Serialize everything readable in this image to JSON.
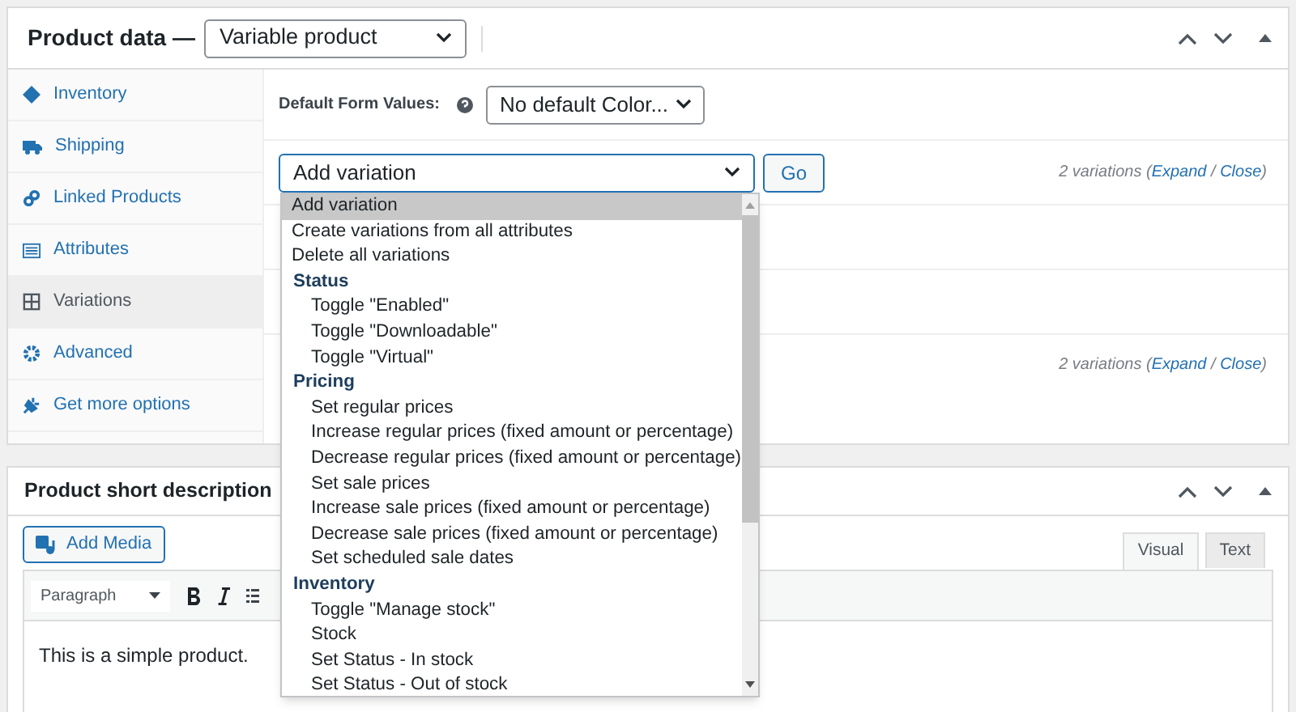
{
  "product_data": {
    "title": "Product data —",
    "type_select": "Variable product",
    "tabs": [
      {
        "label": "Inventory",
        "selected": false
      },
      {
        "label": "Shipping",
        "selected": false
      },
      {
        "label": "Linked Products",
        "selected": false
      },
      {
        "label": "Attributes",
        "selected": false
      },
      {
        "label": "Variations",
        "selected": true
      },
      {
        "label": "Advanced",
        "selected": false
      },
      {
        "label": "Get more options",
        "selected": false
      }
    ],
    "default_form_label": "Default Form Values:",
    "default_select": "No default Color...",
    "add_variation_select": "Add variation",
    "go_button": "Go",
    "variation_counts": [
      {
        "prefix": "2 variations (",
        "expand": "Expand",
        "separator": "/",
        "close": "Close",
        "suffix": ")"
      },
      {
        "prefix": "2 variations (",
        "expand": "Expand",
        "separator": "/",
        "close": "Close",
        "suffix": ")"
      }
    ],
    "dropdown": [
      {
        "kind": "option",
        "label": "Add variation",
        "selected": true
      },
      {
        "kind": "option",
        "label": "Create variations from all attributes",
        "selected": false
      },
      {
        "kind": "option",
        "label": "Delete all variations",
        "selected": false
      },
      {
        "kind": "group",
        "label": "Status",
        "children": [
          {
            "label": "Toggle \"Enabled\"",
            "selected": false
          },
          {
            "label": "Toggle \"Downloadable\"",
            "selected": false
          },
          {
            "label": "Toggle \"Virtual\"",
            "selected": false
          }
        ]
      },
      {
        "kind": "group",
        "label": "Pricing",
        "children": [
          {
            "label": "Set regular prices",
            "selected": false
          },
          {
            "label": "Increase regular prices (fixed amount or percentage)",
            "selected": false
          },
          {
            "label": "Decrease regular prices (fixed amount or percentage)",
            "selected": false
          },
          {
            "label": "Set sale prices",
            "selected": false
          },
          {
            "label": "Increase sale prices (fixed amount or percentage)",
            "selected": false
          },
          {
            "label": "Decrease sale prices (fixed amount or percentage)",
            "selected": false
          },
          {
            "label": "Set scheduled sale dates",
            "selected": false
          }
        ]
      },
      {
        "kind": "group",
        "label": "Inventory",
        "children": [
          {
            "label": "Toggle \"Manage stock\"",
            "selected": false
          },
          {
            "label": "Stock",
            "selected": false
          },
          {
            "label": "Set Status - In stock",
            "selected": false
          },
          {
            "label": "Set Status - Out of stock",
            "selected": false
          }
        ]
      }
    ]
  },
  "short_description": {
    "title": "Product short description",
    "add_media": "Add Media",
    "format_select": "Paragraph",
    "tabs": [
      {
        "label": "Visual",
        "selected": true
      },
      {
        "label": "Text",
        "selected": false
      }
    ],
    "content": "This is a simple product."
  }
}
